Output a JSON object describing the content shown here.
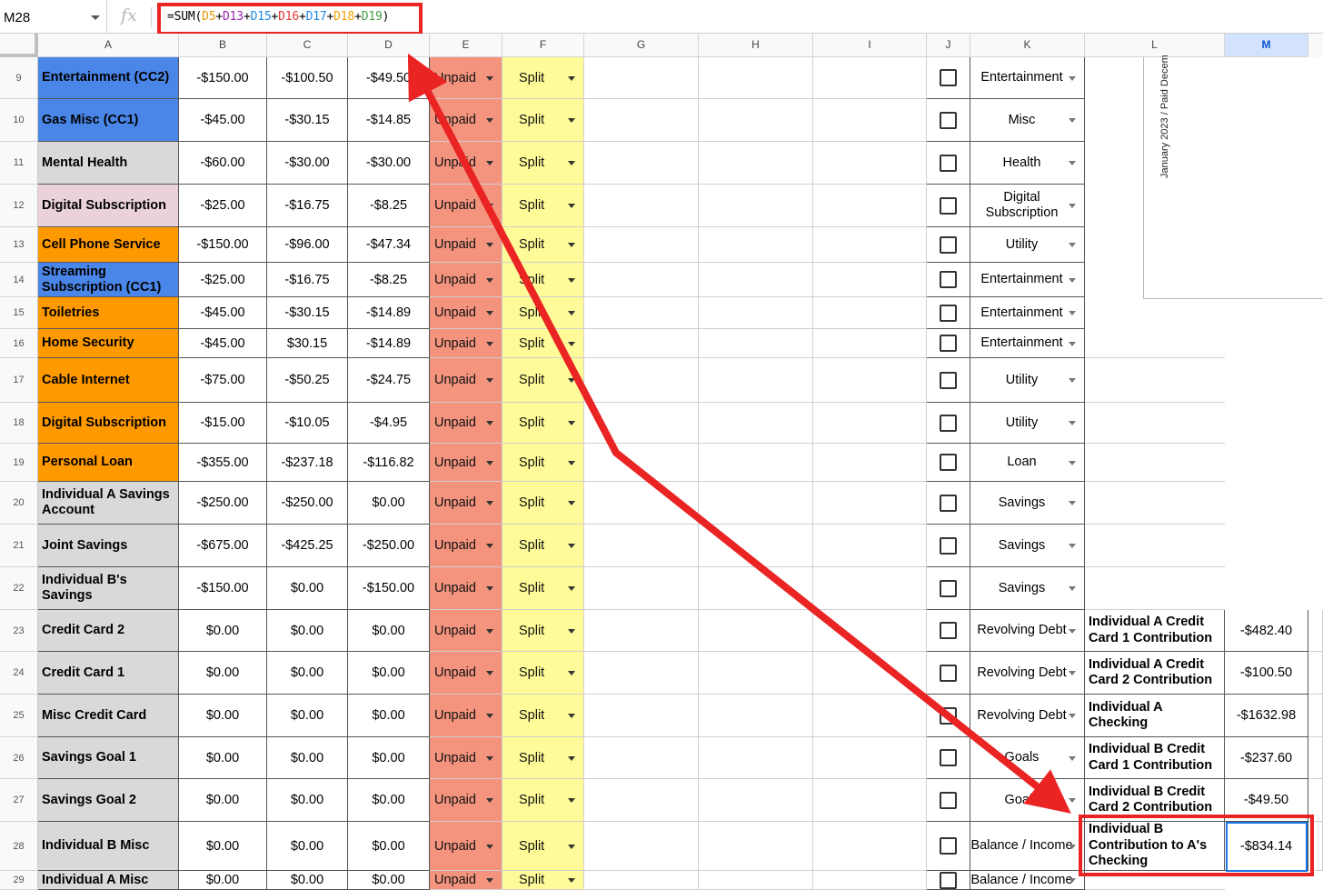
{
  "name_box": "M28",
  "fx_label": "fx",
  "formula": {
    "parts": [
      {
        "t": "=SUM(",
        "c": "#000000"
      },
      {
        "t": "D5",
        "c": "#e69a00"
      },
      {
        "t": "+",
        "c": "#000000"
      },
      {
        "t": "D13",
        "c": "#9c27b0"
      },
      {
        "t": "+",
        "c": "#000000"
      },
      {
        "t": "D15",
        "c": "#1e88e5"
      },
      {
        "t": "+",
        "c": "#000000"
      },
      {
        "t": "D16",
        "c": "#e53935"
      },
      {
        "t": "+",
        "c": "#000000"
      },
      {
        "t": "D17",
        "c": "#1e88e5"
      },
      {
        "t": "+",
        "c": "#000000"
      },
      {
        "t": "D18",
        "c": "#f4a300"
      },
      {
        "t": "+",
        "c": "#000000"
      },
      {
        "t": "D19",
        "c": "#43a047"
      },
      {
        "t": ")",
        "c": "#000000"
      }
    ]
  },
  "columns": [
    "A",
    "B",
    "C",
    "D",
    "E",
    "F",
    "G",
    "H",
    "I",
    "J",
    "K",
    "L",
    "M"
  ],
  "selected_column": "M",
  "chart_title": "January 2023 / Paid Decem",
  "colors": {
    "blue": "#4a86e8",
    "grey": "#d9d9d9",
    "pink": "#ead1dc",
    "orange": "#ff9900",
    "unpaid": "#f4947f",
    "split": "#fefb98",
    "highlight": "#ea2323",
    "selection": "#1a73e8"
  },
  "rows": [
    {
      "n": "9",
      "name": "Entertainment (CC2)",
      "bg": "#4a86e8",
      "b": "-$150.00",
      "c": "-$100.50",
      "d": "-$49.50",
      "e": "Unpaid",
      "f": "Split",
      "k": "Entertainment"
    },
    {
      "n": "10",
      "name": "Gas Misc (CC1)",
      "bg": "#4a86e8",
      "b": "-$45.00",
      "c": "-$30.15",
      "d": "-$14.85",
      "e": "Unpaid",
      "f": "Split",
      "k": "Misc"
    },
    {
      "n": "11",
      "name": "Mental Health",
      "bg": "#d9d9d9",
      "b": "-$60.00",
      "c": "-$30.00",
      "d": "-$30.00",
      "e": "Unpaid",
      "f": "Split",
      "k": "Health"
    },
    {
      "n": "12",
      "name": "Digital Subscription",
      "bg": "#ead1dc",
      "b": "-$25.00",
      "c": "-$16.75",
      "d": "-$8.25",
      "e": "Unpaid",
      "f": "Split",
      "k": "Digital Subscription"
    },
    {
      "n": "13",
      "name": "Cell Phone Service",
      "bg": "#ff9900",
      "b": "-$150.00",
      "c": "-$96.00",
      "d": "-$47.34",
      "e": "Unpaid",
      "f": "Split",
      "k": "Utility"
    },
    {
      "n": "14",
      "name": "Streaming Subscription (CC1)",
      "bg": "#4a86e8",
      "b": "-$25.00",
      "c": "-$16.75",
      "d": "-$8.25",
      "e": "Unpaid",
      "f": "Split",
      "k": "Entertainment"
    },
    {
      "n": "15",
      "name": "Toiletries",
      "bg": "#ff9900",
      "b": "-$45.00",
      "c": "-$30.15",
      "d": "-$14.89",
      "e": "Unpaid",
      "f": "Split",
      "k": "Entertainment"
    },
    {
      "n": "16",
      "name": "Home Security",
      "bg": "#ff9900",
      "b": "-$45.00",
      "c": "$30.15",
      "d": "-$14.89",
      "e": "Unpaid",
      "f": "Split",
      "k": "Entertainment"
    },
    {
      "n": "17",
      "name": "Cable Internet",
      "bg": "#ff9900",
      "b": "-$75.00",
      "c": "-$50.25",
      "d": "-$24.75",
      "e": "Unpaid",
      "f": "Split",
      "k": "Utility"
    },
    {
      "n": "18",
      "name": "Digital Subscription",
      "bg": "#ff9900",
      "b": "-$15.00",
      "c": "-$10.05",
      "d": "-$4.95",
      "e": "Unpaid",
      "f": "Split",
      "k": "Utility"
    },
    {
      "n": "19",
      "name": "Personal Loan",
      "bg": "#ff9900",
      "b": "-$355.00",
      "c": "-$237.18",
      "d": "-$116.82",
      "e": "Unpaid",
      "f": "Split",
      "k": "Loan"
    },
    {
      "n": "20",
      "name": "Individual A Savings Account",
      "bg": "#d9d9d9",
      "b": "-$250.00",
      "c": "-$250.00",
      "d": "$0.00",
      "e": "Unpaid",
      "f": "Split",
      "k": "Savings"
    },
    {
      "n": "21",
      "name": "Joint Savings",
      "bg": "#d9d9d9",
      "b": "-$675.00",
      "c": "-$425.25",
      "d": "-$250.00",
      "e": "Unpaid",
      "f": "Split",
      "k": "Savings"
    },
    {
      "n": "22",
      "name": "Individual B's Savings",
      "bg": "#d9d9d9",
      "b": "-$150.00",
      "c": "$0.00",
      "d": "-$150.00",
      "e": "Unpaid",
      "f": "Split",
      "k": "Savings"
    },
    {
      "n": "23",
      "name": "Credit Card 2",
      "bg": "#d9d9d9",
      "b": "$0.00",
      "c": "$0.00",
      "d": "$0.00",
      "e": "Unpaid",
      "f": "Split",
      "k": "Revolving Debt",
      "l": "Individual A Credit Card 1 Contribution",
      "m": "-$482.40"
    },
    {
      "n": "24",
      "name": "Credit Card 1",
      "bg": "#d9d9d9",
      "b": "$0.00",
      "c": "$0.00",
      "d": "$0.00",
      "e": "Unpaid",
      "f": "Split",
      "k": "Revolving Debt",
      "l": "Individual A Credit Card 2 Contribution",
      "m": "-$100.50"
    },
    {
      "n": "25",
      "name": "Misc Credit Card",
      "bg": "#d9d9d9",
      "b": "$0.00",
      "c": "$0.00",
      "d": "$0.00",
      "e": "Unpaid",
      "f": "Split",
      "k": "Revolving Debt",
      "l": "Individual A Checking",
      "m": "-$1632.98"
    },
    {
      "n": "26",
      "name": "Savings Goal 1",
      "bg": "#d9d9d9",
      "b": "$0.00",
      "c": "$0.00",
      "d": "$0.00",
      "e": "Unpaid",
      "f": "Split",
      "k": "Goals",
      "l": "Individual B Credit Card 1 Contribution",
      "m": "-$237.60"
    },
    {
      "n": "27",
      "name": "Savings Goal 2",
      "bg": "#d9d9d9",
      "b": "$0.00",
      "c": "$0.00",
      "d": "$0.00",
      "e": "Unpaid",
      "f": "Split",
      "k": "Goals",
      "l": "Individual B Credit Card 2 Contribution",
      "m": "-$49.50"
    },
    {
      "n": "28",
      "name": "Individual B Misc",
      "bg": "#d9d9d9",
      "b": "$0.00",
      "c": "$0.00",
      "d": "$0.00",
      "e": "Unpaid",
      "f": "Split",
      "k": "Balance / Income",
      "l": "Individual B Contribution to A's Checking",
      "m": "-$834.14"
    },
    {
      "n": "29",
      "name": "Individual A Misc",
      "bg": "#d9d9d9",
      "b": "$0.00",
      "c": "$0.00",
      "d": "$0.00",
      "e": "Unpaid",
      "f": "Split",
      "k": "Balance / Income"
    }
  ]
}
